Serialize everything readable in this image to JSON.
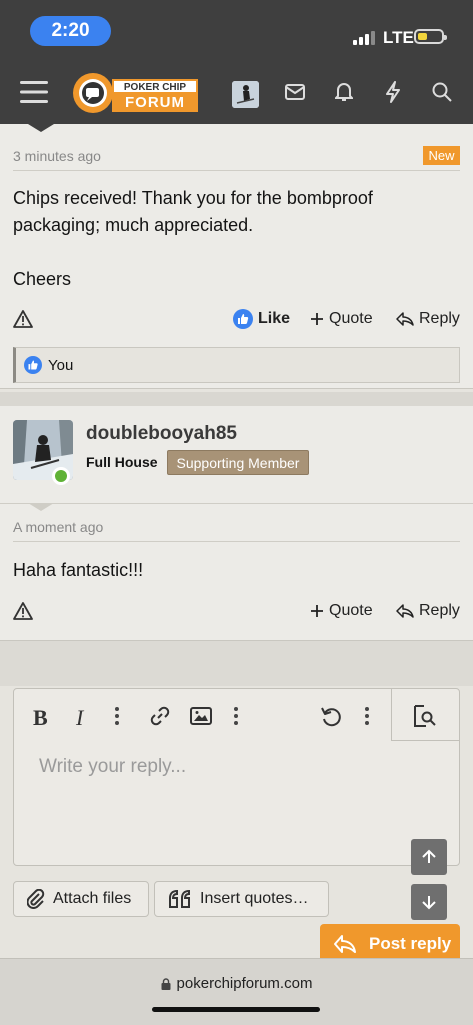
{
  "status_bar": {
    "time": "2:20",
    "network": "LTE"
  },
  "header": {
    "logo_line1": "POKER CHIP",
    "logo_line2": "FORUM"
  },
  "post1": {
    "timestamp": "3 minutes ago",
    "badge": "New",
    "body_line1": "Chips received! Thank you for the bombproof",
    "body_line2": "packaging; much appreciated.",
    "body_line3": "Cheers",
    "like_label": "Like",
    "quote_label": "Quote",
    "reply_label": "Reply",
    "likes_text": "You"
  },
  "post2": {
    "username": "doublebooyah85",
    "rank": "Full House",
    "member_badge": "Supporting Member",
    "timestamp": "A moment ago",
    "body": "Haha fantastic!!!",
    "quote_label": "Quote",
    "reply_label": "Reply"
  },
  "editor": {
    "placeholder": "Write your reply...",
    "attach_label": "Attach files",
    "insert_quotes_label": "Insert quotes…",
    "post_reply_label": "Post reply"
  },
  "browser": {
    "url": "pokerchipforum.com"
  },
  "colors": {
    "accent": "#f0982c",
    "header_bg": "#3f3f3f",
    "like_blue": "#3b82f0",
    "online_green": "#5fb236"
  }
}
